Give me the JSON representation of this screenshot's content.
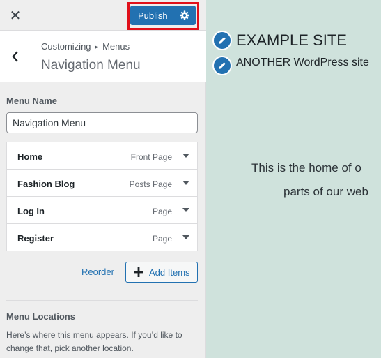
{
  "topbar": {
    "close_glyph": "✕",
    "publish_label": "Publish"
  },
  "breadcrumb": {
    "root": "Customizing",
    "separator": "▸",
    "parent": "Menus",
    "title": "Navigation Menu"
  },
  "menu_name": {
    "label": "Menu Name",
    "value": "Navigation Menu"
  },
  "menu_items": [
    {
      "title": "Home",
      "type": "Front Page"
    },
    {
      "title": "Fashion Blog",
      "type": "Posts Page"
    },
    {
      "title": "Log In",
      "type": "Page"
    },
    {
      "title": "Register",
      "type": "Page"
    }
  ],
  "actions": {
    "reorder_label": "Reorder",
    "add_items_label": "Add Items"
  },
  "locations": {
    "title": "Menu Locations",
    "description": "Here’s where this menu appears. If you’d like to change that, pick another location."
  },
  "preview": {
    "site_title": "EXAMPLE SITE",
    "tagline": "ANOTHER WordPress site",
    "body_line1": "This is the home of o",
    "body_line2": "parts of our web"
  },
  "colors": {
    "accent": "#2271b1",
    "highlight": "#e0101a",
    "preview_bg": "#cfe2dc"
  }
}
